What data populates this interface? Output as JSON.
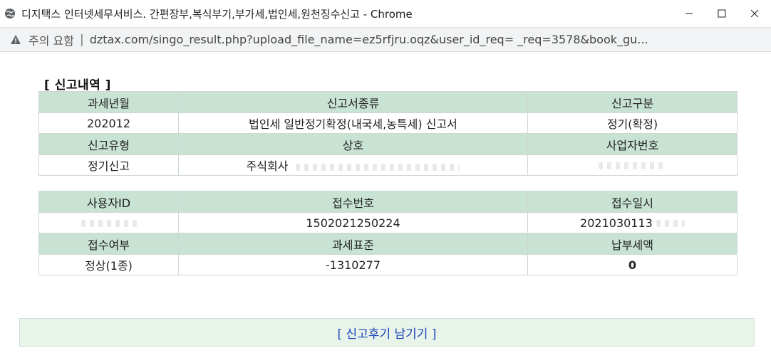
{
  "window": {
    "title": "디지택스 인터넷세무서비스. 간편장부,복식부기,부가세,법인세,원천징수신고 - Chrome",
    "buttons": [
      "minimize",
      "maximize",
      "close"
    ]
  },
  "address_bar": {
    "security_label": "주의 요함",
    "separator": "|",
    "url": "dztax.com/singo_result.php?upload_file_name=ez5rfjru.oqz&user_id_req=                                  _req=3578&book_gu..."
  },
  "report": {
    "section_title": "[ 신고내역 ]",
    "table1": {
      "row1_headers": [
        "과세년월",
        "신고서종류",
        "신고구분"
      ],
      "row1_values": [
        "202012",
        "법인세 일반정기확정(내국세,농특세) 신고서",
        "정기(확정)"
      ],
      "row2_headers": [
        "신고유형",
        "상호",
        "사업자번호"
      ],
      "row2_values": [
        "정기신고",
        "주식회사",
        ""
      ]
    },
    "table2": {
      "row1_headers": [
        "사용자ID",
        "접수번호",
        "접수일시"
      ],
      "row1_values": [
        "",
        "1502021250224",
        "2021030113"
      ],
      "row2_headers": [
        "접수여부",
        "과세표준",
        "납부세액"
      ],
      "row2_values": [
        "정상(1종)",
        "-1310277",
        "0"
      ]
    },
    "footer_link": "[ 신고후기 남기기 ]"
  },
  "icons": {
    "globe": "globe-icon",
    "warning": "warning-icon",
    "minimize": "minimize-icon",
    "maximize": "maximize-icon",
    "close": "close-icon"
  },
  "colors": {
    "header_bg": "#c8e2d3",
    "footer_bg": "#e8f3ea",
    "link": "#1a44b8"
  }
}
